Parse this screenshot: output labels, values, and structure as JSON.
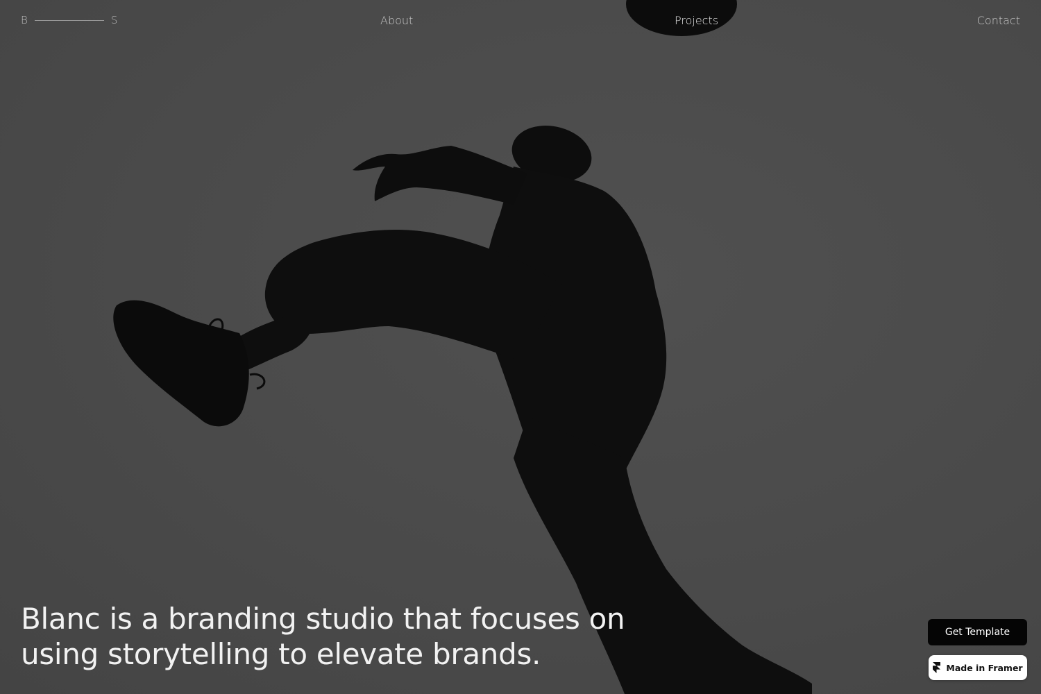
{
  "nav": {
    "logo_left": "B",
    "logo_right": "S",
    "links": [
      {
        "label": "About"
      },
      {
        "label": "Projects"
      },
      {
        "label": "Contact"
      }
    ]
  },
  "hero": {
    "headline_line1": "Blanc is a branding studio that focuses on",
    "headline_line2": "using storytelling to elevate brands."
  },
  "badges": {
    "get_template_label": "Get Template",
    "made_in_framer_label": "Made in Framer",
    "framer_icon": "framer-logo-icon"
  },
  "colors": {
    "background": "#4a4a4a",
    "silhouette": "#0d0d0d",
    "headline_text": "#f2f2f2"
  }
}
